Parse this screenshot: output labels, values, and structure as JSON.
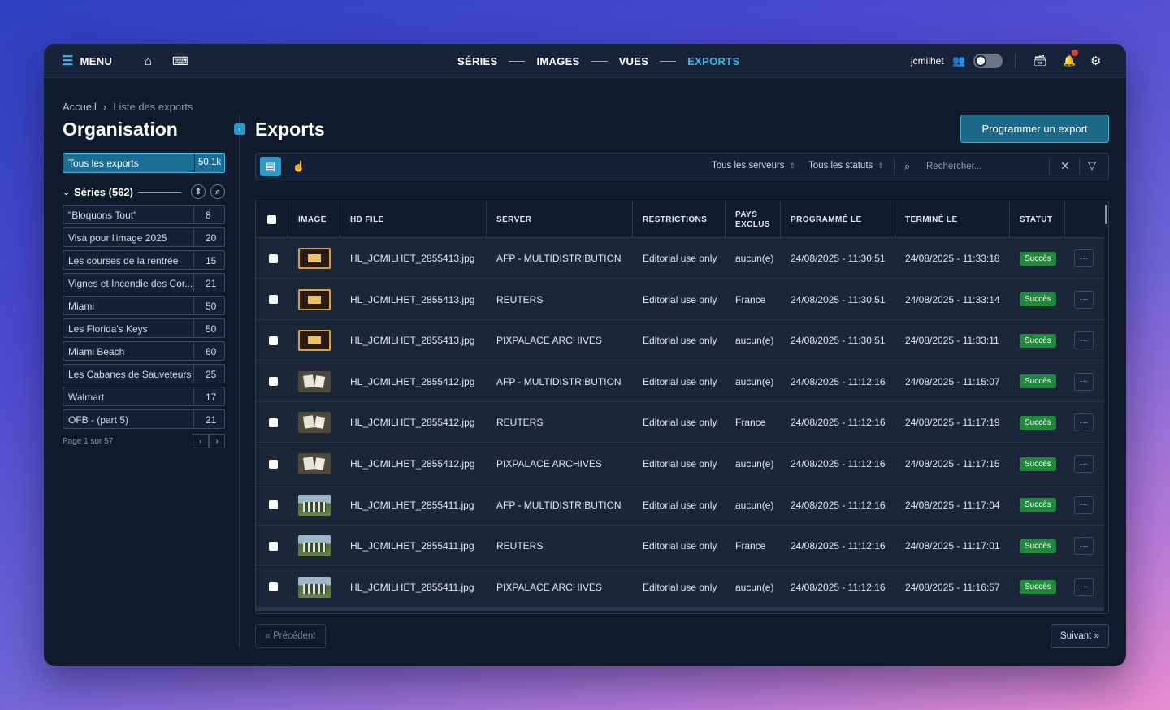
{
  "topbar": {
    "menu_label": "MENU",
    "nav": [
      {
        "label": "SÉRIES",
        "active": false
      },
      {
        "label": "IMAGES",
        "active": false
      },
      {
        "label": "VUES",
        "active": false
      },
      {
        "label": "EXPORTS",
        "active": true
      }
    ],
    "username": "jcmilhet",
    "accent_color": "#3cb6e0",
    "icons": [
      "hamburger-icon",
      "home-icon",
      "keyboard-icon",
      "users-icon",
      "archive-icon",
      "bell-icon",
      "gear-icon"
    ]
  },
  "sidebar": {
    "breadcrumb": {
      "home": "Accueil",
      "current": "Liste des exports"
    },
    "title": "Organisation",
    "all_exports": {
      "label": "Tous les exports",
      "count": "50.1k"
    },
    "series_header": "Séries (562)",
    "series": [
      {
        "label": "\"Bloquons Tout\"",
        "count": "8"
      },
      {
        "label": "Visa pour l'image 2025",
        "count": "20"
      },
      {
        "label": "Les courses de la rentrée",
        "count": "15"
      },
      {
        "label": "Vignes et Incendie des Cor...",
        "count": "21"
      },
      {
        "label": "Miami",
        "count": "50"
      },
      {
        "label": "Les Florida's Keys",
        "count": "50"
      },
      {
        "label": "Miami Beach",
        "count": "60"
      },
      {
        "label": "Les Cabanes de Sauveteurs ...",
        "count": "25"
      },
      {
        "label": "Walmart",
        "count": "17"
      },
      {
        "label": "OFB - (part 5)",
        "count": "21"
      }
    ],
    "page_info": "Page 1 sur 57"
  },
  "main": {
    "title": "Exports",
    "program_button": "Programmer un export",
    "filters": {
      "servers": "Tous les serveurs",
      "statuses": "Tous les statuts"
    },
    "search_placeholder": "Rechercher...",
    "columns": [
      "IMAGE",
      "HD FILE",
      "SERVER",
      "RESTRICTIONS",
      "PAYS EXCLUS",
      "PROGRAMMÉ LE",
      "TERMINÉ LE",
      "STATUT"
    ],
    "rows": [
      {
        "thumb": "t1",
        "file": "HL_JCMILHET_2855413.jpg",
        "server": "AFP - MULTIDISTRIBUTION",
        "restrictions": "Editorial use only",
        "pays": "aucun(e)",
        "programme": "24/08/2025 - 11:30:51",
        "termine": "24/08/2025 - 11:33:18",
        "statut": "Succès"
      },
      {
        "thumb": "t1",
        "file": "HL_JCMILHET_2855413.jpg",
        "server": "REUTERS",
        "restrictions": "Editorial use only",
        "pays": "France",
        "programme": "24/08/2025 - 11:30:51",
        "termine": "24/08/2025 - 11:33:14",
        "statut": "Succès"
      },
      {
        "thumb": "t1",
        "file": "HL_JCMILHET_2855413.jpg",
        "server": "PIXPALACE ARCHIVES",
        "restrictions": "Editorial use only",
        "pays": "aucun(e)",
        "programme": "24/08/2025 - 11:30:51",
        "termine": "24/08/2025 - 11:33:11",
        "statut": "Succès"
      },
      {
        "thumb": "t2",
        "file": "HL_JCMILHET_2855412.jpg",
        "server": "AFP - MULTIDISTRIBUTION",
        "restrictions": "Editorial use only",
        "pays": "aucun(e)",
        "programme": "24/08/2025 - 11:12:16",
        "termine": "24/08/2025 - 11:15:07",
        "statut": "Succès"
      },
      {
        "thumb": "t2",
        "file": "HL_JCMILHET_2855412.jpg",
        "server": "REUTERS",
        "restrictions": "Editorial use only",
        "pays": "France",
        "programme": "24/08/2025 - 11:12:16",
        "termine": "24/08/2025 - 11:17:19",
        "statut": "Succès"
      },
      {
        "thumb": "t2",
        "file": "HL_JCMILHET_2855412.jpg",
        "server": "PIXPALACE ARCHIVES",
        "restrictions": "Editorial use only",
        "pays": "aucun(e)",
        "programme": "24/08/2025 - 11:12:16",
        "termine": "24/08/2025 - 11:17:15",
        "statut": "Succès"
      },
      {
        "thumb": "t3",
        "file": "HL_JCMILHET_2855411.jpg",
        "server": "AFP - MULTIDISTRIBUTION",
        "restrictions": "Editorial use only",
        "pays": "aucun(e)",
        "programme": "24/08/2025 - 11:12:16",
        "termine": "24/08/2025 - 11:17:04",
        "statut": "Succès"
      },
      {
        "thumb": "t3",
        "file": "HL_JCMILHET_2855411.jpg",
        "server": "REUTERS",
        "restrictions": "Editorial use only",
        "pays": "France",
        "programme": "24/08/2025 - 11:12:16",
        "termine": "24/08/2025 - 11:17:01",
        "statut": "Succès"
      },
      {
        "thumb": "t3",
        "file": "HL_JCMILHET_2855411.jpg",
        "server": "PIXPALACE ARCHIVES",
        "restrictions": "Editorial use only",
        "pays": "aucun(e)",
        "programme": "24/08/2025 - 11:12:16",
        "termine": "24/08/2025 - 11:16:57",
        "statut": "Succès"
      }
    ],
    "more_label": "···",
    "prev_label": "« Précédent",
    "next_label": "Suivant »",
    "success_color": "#1f8a3c"
  }
}
